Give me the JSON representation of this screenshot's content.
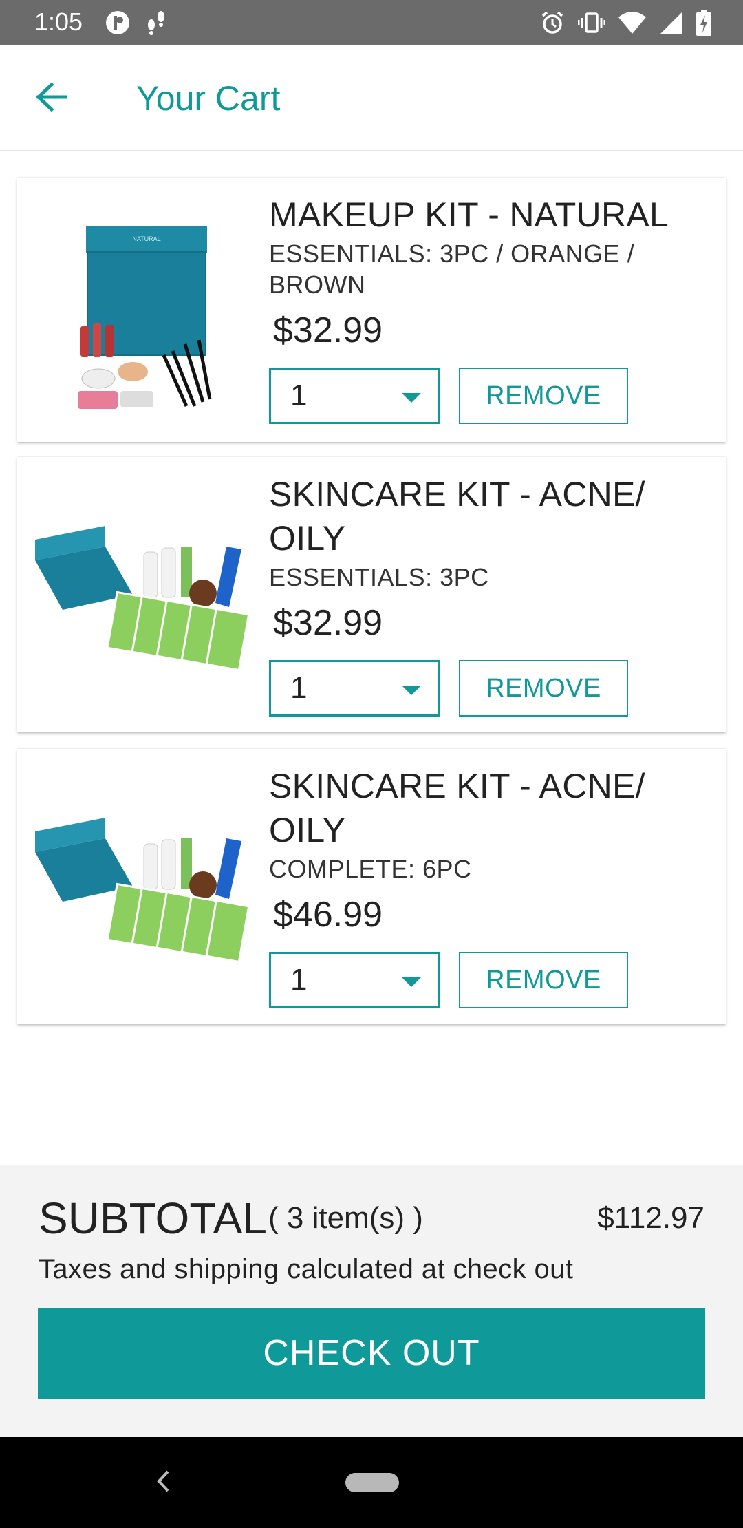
{
  "status_bar": {
    "time": "1:05"
  },
  "header": {
    "title": "Your Cart",
    "back_icon": "arrow-back-icon"
  },
  "cart": {
    "items": [
      {
        "name": "MAKEUP KIT - NATURAL",
        "variant": "ESSENTIALS: 3PC / ORANGE / BROWN",
        "price": "$32.99",
        "quantity": "1",
        "remove_label": "REMOVE"
      },
      {
        "name": "SKINCARE KIT - ACNE/ OILY",
        "variant": "ESSENTIALS: 3PC",
        "price": "$32.99",
        "quantity": "1",
        "remove_label": "REMOVE"
      },
      {
        "name": "SKINCARE KIT - ACNE/ OILY",
        "variant": "COMPLETE: 6PC",
        "price": "$46.99",
        "quantity": "1",
        "remove_label": "REMOVE"
      }
    ]
  },
  "footer": {
    "subtotal_label": "SUBTOTAL",
    "item_count": "( 3 item(s) )",
    "subtotal_amount": "$112.97",
    "tax_note": "Taxes and shipping calculated at check out",
    "checkout_label": "CHECK OUT"
  },
  "colors": {
    "accent": "#0f9a99",
    "status_bar": "#6b6b6b",
    "footer_bg": "#f3f3f3"
  }
}
